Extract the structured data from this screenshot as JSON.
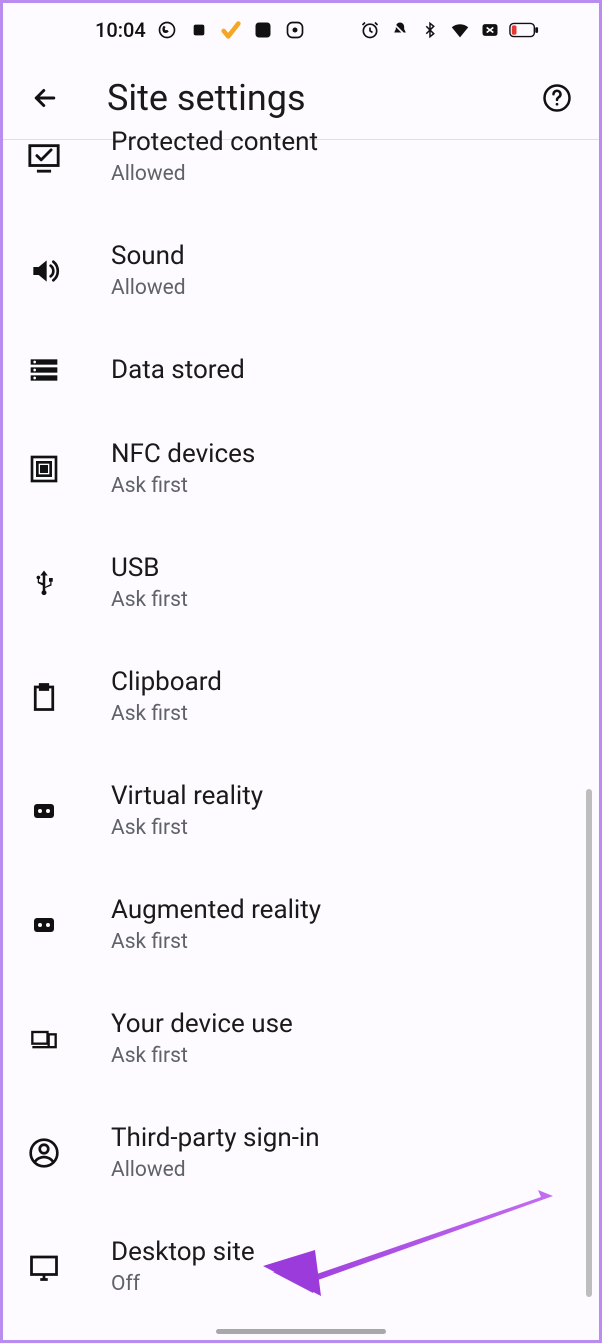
{
  "status": {
    "time": "10:04"
  },
  "header": {
    "title": "Site settings"
  },
  "items": [
    {
      "title": "Protected content",
      "sub": "Allowed"
    },
    {
      "title": "Sound",
      "sub": "Allowed"
    },
    {
      "title": "Data stored",
      "sub": ""
    },
    {
      "title": "NFC devices",
      "sub": "Ask first"
    },
    {
      "title": "USB",
      "sub": "Ask first"
    },
    {
      "title": "Clipboard",
      "sub": "Ask first"
    },
    {
      "title": "Virtual reality",
      "sub": "Ask first"
    },
    {
      "title": "Augmented reality",
      "sub": "Ask first"
    },
    {
      "title": "Your device use",
      "sub": "Ask first"
    },
    {
      "title": "Third-party sign-in",
      "sub": "Allowed"
    },
    {
      "title": "Desktop site",
      "sub": "Off"
    }
  ]
}
